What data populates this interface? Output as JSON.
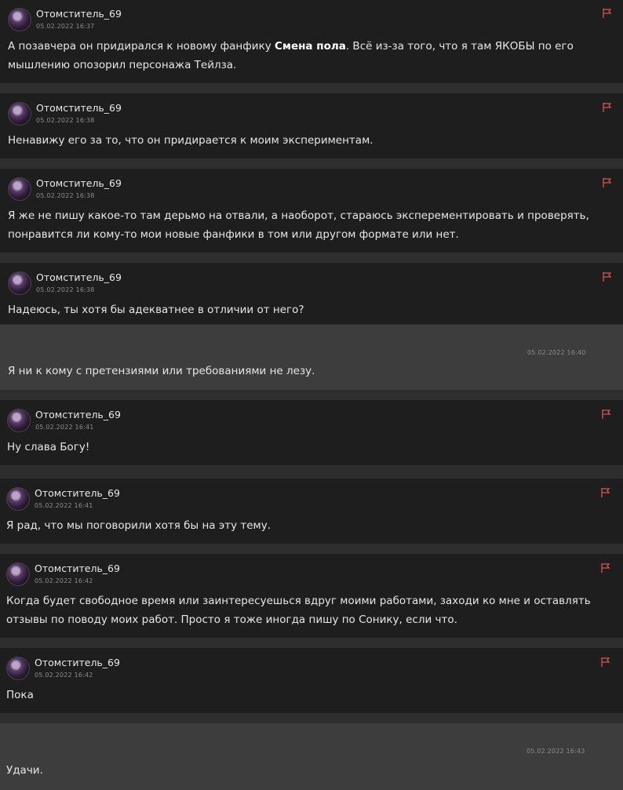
{
  "messages": [
    {
      "author": "Отомститель_69",
      "time": "05.02.2022 16:37",
      "line1_pre": "А позавчера он придирался к новому фанфику ",
      "line1_bold": "Смена пола",
      "line1_post": ". Всё из-за того, что я там ЯКОБЫ по его",
      "line2": "мышлению опозорил персонажа Тейлза."
    },
    {
      "author": "Отомститель_69",
      "time": "05.02.2022 16:38",
      "line1": "Ненавижу его за то, что он придирается к моим экспериментам."
    },
    {
      "author": "Отомститель_69",
      "time": "05.02.2022 16:38",
      "line1": "Я же не пишу какое-то там дерьмо на отвали, а наоборот, стараюсь эксперементировать и проверять,",
      "line2": "понравится ли кому-то мои новые фанфики в том или другом формате или нет."
    },
    {
      "author": "Отомститель_69",
      "time": "05.02.2022 16:38",
      "line1": "Надеюсь, ты хотя бы адекватнее в отличии от него?"
    },
    {
      "own": true,
      "time": "05.02.2022 16:40",
      "line1": "Я ни к кому с претензиями или требованиями не лезу."
    },
    {
      "author": "Отомститель_69",
      "time": "05.02.2022 16:41",
      "line1": "Ну слава Богу!"
    },
    {
      "author": "Отомститель_69",
      "time": "05.02.2022 16:41",
      "line1": "Я рад, что мы поговорили хотя бы на эту тему."
    },
    {
      "author": "Отомститель_69",
      "time": "05.02.2022 16:42",
      "line1": "Когда будет свободное время или заинтересуешься вдруг моими работами, заходи ко мне и оставлять",
      "line2": "отзывы по поводу моих работ. Просто я тоже иногда пишу по Сонику, если что."
    },
    {
      "author": "Отомститель_69",
      "time": "05.02.2022 16:42",
      "line1": "Пока"
    },
    {
      "own": true,
      "time": "05.02.2022 16:43",
      "line1": "Удачи."
    }
  ],
  "icons": {
    "flag": "report-flag-icon",
    "avatar": "user-avatar"
  },
  "colors": {
    "flag": "#d9534f",
    "own_bg": "#3d3d3d",
    "other_bg": "#1e1e1e"
  }
}
